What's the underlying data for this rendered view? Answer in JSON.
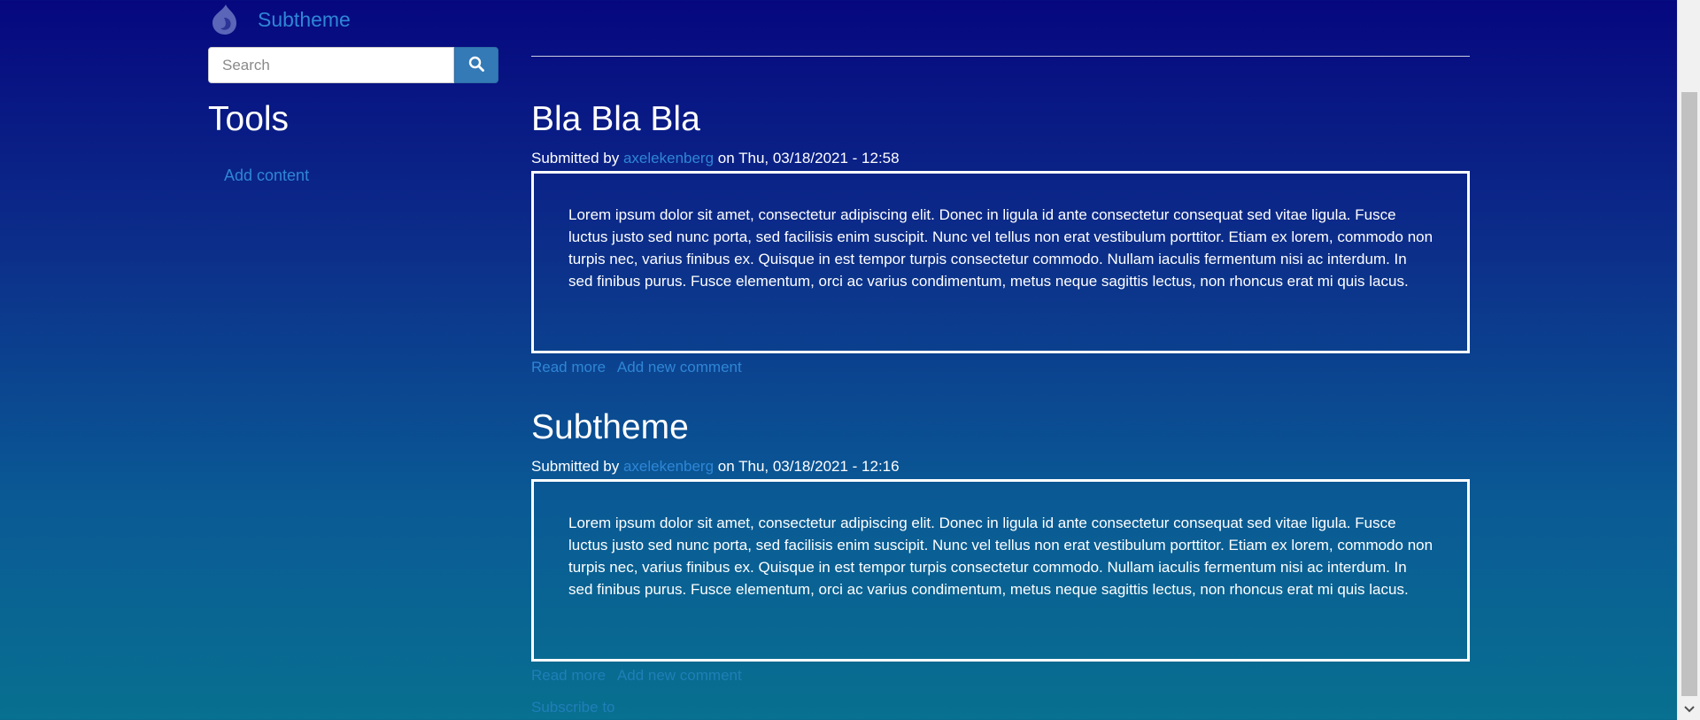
{
  "site": {
    "name": "Subtheme",
    "logo_icon": "drupal-drop-icon"
  },
  "search": {
    "placeholder": "Search",
    "value": "",
    "button_icon": "search-icon"
  },
  "sidebar": {
    "title": "Tools",
    "links": [
      {
        "label": "Add content"
      }
    ]
  },
  "articles": [
    {
      "title": "Bla Bla Bla",
      "submitted_prefix": "Submitted by",
      "author": "axelekenberg",
      "date": "on Thu, 03/18/2021 - 12:58",
      "body": "Lorem ipsum dolor sit amet, consectetur adipiscing elit. Donec in ligula id ante consectetur consequat sed vitae ligula. Fusce luctus justo sed nunc porta, sed facilisis enim suscipit. Nunc vel tellus non erat vestibulum porttitor. Etiam ex lorem, commodo non turpis nec, varius finibus ex. Quisque in est tempor turpis consectetur commodo. Nullam iaculis fermentum nisi ac interdum. In sed finibus purus. Fusce elementum, orci ac varius condimentum, metus neque sagittis lectus, non rhoncus erat mi quis lacus.",
      "read_more": "Read more",
      "add_comment": "Add new comment"
    },
    {
      "title": "Subtheme",
      "submitted_prefix": "Submitted by",
      "author": "axelekenberg",
      "date": "on Thu, 03/18/2021 - 12:16",
      "body": "Lorem ipsum dolor sit amet, consectetur adipiscing elit. Donec in ligula id ante consectetur consequat sed vitae ligula. Fusce luctus justo sed nunc porta, sed facilisis enim suscipit. Nunc vel tellus non erat vestibulum porttitor. Etiam ex lorem, commodo non turpis nec, varius finibus ex. Quisque in est tempor turpis consectetur commodo. Nullam iaculis fermentum nisi ac interdum. In sed finibus purus. Fusce elementum, orci ac varius condimentum, metus neque sagittis lectus, non rhoncus erat mi quis lacus.",
      "read_more": "Read more",
      "add_comment": "Add new comment"
    }
  ],
  "feed": {
    "label": "Subscribe to"
  },
  "colors": {
    "link": "#2f86d6",
    "button": "#337ab7",
    "gradient_top": "#06077f",
    "gradient_bottom": "#087090"
  }
}
